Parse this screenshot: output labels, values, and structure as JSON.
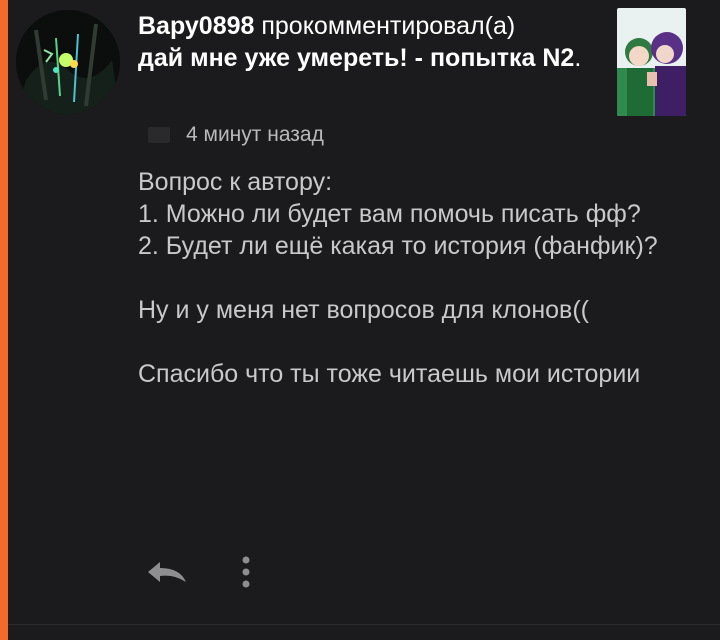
{
  "colors": {
    "accent": "#f26b2a",
    "background": "#1b1b1d",
    "text_primary": "#ffffff",
    "text_secondary": "#c9c9cb",
    "icon": "#8e8e90"
  },
  "notification": {
    "username": "Вару0898",
    "action": " прокомментировал(а)",
    "post_title": "дай мне уже умереть! - попытка N2",
    "post_title_end": ".",
    "time": "4 минут назад",
    "message": "Вопрос к автору:\n1. Можно ли будет вам помочь писать фф?\n2. Будет ли ещё какая то история (фанфик)?\n\nНу и у меня нет вопросов для клонов((\n\nСпасибо что ты тоже читаешь мои истории"
  },
  "icons": {
    "reply": "reply-arrow-icon",
    "more": "vertical-dots-icon"
  }
}
